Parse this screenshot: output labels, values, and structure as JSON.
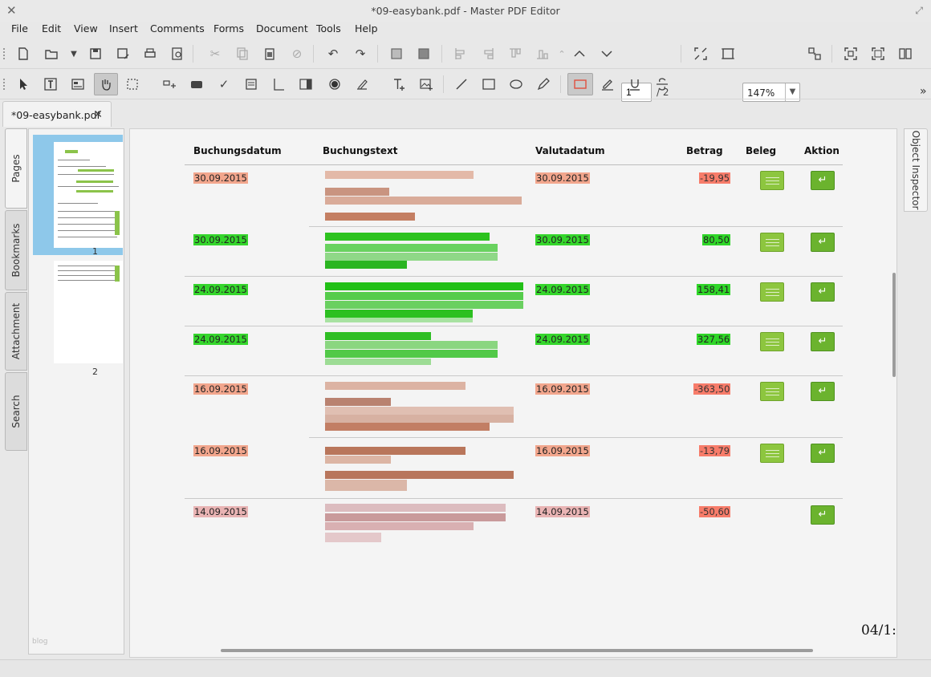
{
  "window": {
    "title": "*09-easybank.pdf - Master PDF Editor"
  },
  "menu": [
    "File",
    "Edit",
    "View",
    "Insert",
    "Comments",
    "Forms",
    "Document",
    "Tools",
    "Help"
  ],
  "navigation": {
    "page": "1",
    "total": "/ 2",
    "zoom": "147%"
  },
  "doc_tab": {
    "label": "*09-easybank.pdf"
  },
  "side_tabs": [
    "Pages",
    "Bookmarks",
    "Attachment",
    "Search"
  ],
  "right_tab": "Object Inspector",
  "thumbnails": {
    "page1": "1",
    "page2": "2",
    "watermark": "blog"
  },
  "table": {
    "headers": {
      "date": "Buchungsdatum",
      "text": "Buchungstext",
      "value_date": "Valutadatum",
      "amount": "Betrag",
      "receipt": "Beleg",
      "action": "Aktion"
    },
    "rows": [
      {
        "date": "30.09.2015",
        "value_date": "30.09.2015",
        "amount": "-19,95",
        "type": "neg",
        "beleg": true
      },
      {
        "date": "30.09.2015",
        "value_date": "30.09.2015",
        "amount": "80,50",
        "type": "pos",
        "beleg": true
      },
      {
        "date": "24.09.2015",
        "value_date": "24.09.2015",
        "amount": "158,41",
        "type": "pos",
        "beleg": true
      },
      {
        "date": "24.09.2015",
        "value_date": "24.09.2015",
        "amount": "327,56",
        "type": "pos",
        "beleg": true
      },
      {
        "date": "16.09.2015",
        "value_date": "16.09.2015",
        "amount": "-363,50",
        "type": "neg",
        "beleg": true
      },
      {
        "date": "16.09.2015",
        "value_date": "16.09.2015",
        "amount": "-13,79",
        "type": "neg",
        "beleg": true
      },
      {
        "date": "14.09.2015",
        "value_date": "14.09.2015",
        "amount": "-50,60",
        "type": "neg2",
        "beleg": false
      }
    ]
  },
  "footer": {
    "page_indicator": "04/1:"
  },
  "colors": {
    "negative": "#f2a68d",
    "positive": "#35d62c",
    "accent": "#8dc63f"
  }
}
